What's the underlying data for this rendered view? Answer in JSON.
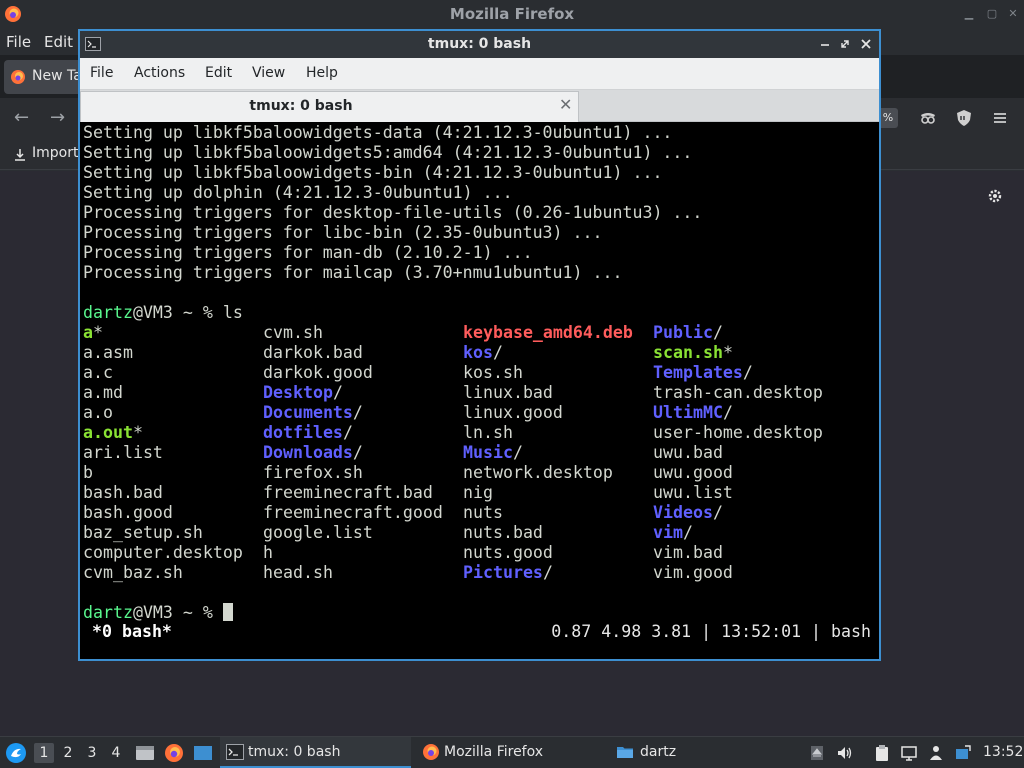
{
  "firefox": {
    "window_title": "Mozilla Firefox",
    "menu": {
      "file": "File",
      "edit": "Edit"
    },
    "tab_label": "New Tab",
    "zoom_label": "%",
    "bookmarks": {
      "import_label": "Import"
    }
  },
  "terminal": {
    "window_title": "tmux: 0 bash",
    "menu": {
      "file": "File",
      "actions": "Actions",
      "edit": "Edit",
      "view": "View",
      "help": "Help"
    },
    "tab_label": "tmux: 0 bash",
    "output_lines": [
      "Setting up libkf5baloowidgets-data (4:21.12.3-0ubuntu1) ...",
      "Setting up libkf5baloowidgets5:amd64 (4:21.12.3-0ubuntu1) ...",
      "Setting up libkf5baloowidgets-bin (4:21.12.3-0ubuntu1) ...",
      "Setting up dolphin (4:21.12.3-0ubuntu1) ...",
      "Processing triggers for desktop-file-utils (0.26-1ubuntu3) ...",
      "Processing triggers for libc-bin (2.35-0ubuntu3) ...",
      "Processing triggers for man-db (2.10.2-1) ...",
      "Processing triggers for mailcap (3.70+nmu1ubuntu1) ..."
    ],
    "prompt": {
      "user": "dartz",
      "host_path": "@VM3 ~ % ",
      "command": "ls"
    },
    "prompt2": {
      "user": "dartz",
      "host_path": "@VM3 ~ % "
    },
    "ls_columns": [
      [
        {
          "name": "a",
          "suffix": "*",
          "kind": "exec"
        },
        {
          "name": "a.asm",
          "suffix": "",
          "kind": "file"
        },
        {
          "name": "a.c",
          "suffix": "",
          "kind": "file"
        },
        {
          "name": "a.md",
          "suffix": "",
          "kind": "file"
        },
        {
          "name": "a.o",
          "suffix": "",
          "kind": "file"
        },
        {
          "name": "a.out",
          "suffix": "*",
          "kind": "exec"
        },
        {
          "name": "ari.list",
          "suffix": "",
          "kind": "file"
        },
        {
          "name": "b",
          "suffix": "",
          "kind": "file"
        },
        {
          "name": "bash.bad",
          "suffix": "",
          "kind": "file"
        },
        {
          "name": "bash.good",
          "suffix": "",
          "kind": "file"
        },
        {
          "name": "baz_setup.sh",
          "suffix": "",
          "kind": "file"
        },
        {
          "name": "computer.desktop",
          "suffix": "",
          "kind": "file"
        },
        {
          "name": "cvm_baz.sh",
          "suffix": "",
          "kind": "file"
        }
      ],
      [
        {
          "name": "cvm.sh",
          "suffix": "",
          "kind": "file"
        },
        {
          "name": "darkok.bad",
          "suffix": "",
          "kind": "file"
        },
        {
          "name": "darkok.good",
          "suffix": "",
          "kind": "file"
        },
        {
          "name": "Desktop",
          "suffix": "/",
          "kind": "dir"
        },
        {
          "name": "Documents",
          "suffix": "/",
          "kind": "dir"
        },
        {
          "name": "dotfiles",
          "suffix": "/",
          "kind": "dir"
        },
        {
          "name": "Downloads",
          "suffix": "/",
          "kind": "dir"
        },
        {
          "name": "firefox.sh",
          "suffix": "",
          "kind": "file"
        },
        {
          "name": "freeminecraft.bad",
          "suffix": "",
          "kind": "file"
        },
        {
          "name": "freeminecraft.good",
          "suffix": "",
          "kind": "file"
        },
        {
          "name": "google.list",
          "suffix": "",
          "kind": "file"
        },
        {
          "name": "h",
          "suffix": "",
          "kind": "file"
        },
        {
          "name": "head.sh",
          "suffix": "",
          "kind": "file"
        }
      ],
      [
        {
          "name": "keybase_amd64.deb",
          "suffix": "",
          "kind": "archive"
        },
        {
          "name": "kos",
          "suffix": "/",
          "kind": "dir"
        },
        {
          "name": "kos.sh",
          "suffix": "",
          "kind": "file"
        },
        {
          "name": "linux.bad",
          "suffix": "",
          "kind": "file"
        },
        {
          "name": "linux.good",
          "suffix": "",
          "kind": "file"
        },
        {
          "name": "ln.sh",
          "suffix": "",
          "kind": "file"
        },
        {
          "name": "Music",
          "suffix": "/",
          "kind": "dir"
        },
        {
          "name": "network.desktop",
          "suffix": "",
          "kind": "file"
        },
        {
          "name": "nig",
          "suffix": "",
          "kind": "file"
        },
        {
          "name": "nuts",
          "suffix": "",
          "kind": "file"
        },
        {
          "name": "nuts.bad",
          "suffix": "",
          "kind": "file"
        },
        {
          "name": "nuts.good",
          "suffix": "",
          "kind": "file"
        },
        {
          "name": "Pictures",
          "suffix": "/",
          "kind": "dir"
        }
      ],
      [
        {
          "name": "Public",
          "suffix": "/",
          "kind": "dir"
        },
        {
          "name": "scan.sh",
          "suffix": "*",
          "kind": "exec"
        },
        {
          "name": "Templates",
          "suffix": "/",
          "kind": "dir"
        },
        {
          "name": "trash-can.desktop",
          "suffix": "",
          "kind": "file"
        },
        {
          "name": "UltimMC",
          "suffix": "/",
          "kind": "dir"
        },
        {
          "name": "user-home.desktop",
          "suffix": "",
          "kind": "file"
        },
        {
          "name": "uwu.bad",
          "suffix": "",
          "kind": "file"
        },
        {
          "name": "uwu.good",
          "suffix": "",
          "kind": "file"
        },
        {
          "name": "uwu.list",
          "suffix": "",
          "kind": "file"
        },
        {
          "name": "Videos",
          "suffix": "/",
          "kind": "dir"
        },
        {
          "name": "vim",
          "suffix": "/",
          "kind": "dir"
        },
        {
          "name": "vim.bad",
          "suffix": "",
          "kind": "file"
        },
        {
          "name": "vim.good",
          "suffix": "",
          "kind": "file"
        }
      ]
    ],
    "status": {
      "left": "*0 bash*",
      "right": "0.87 4.98 3.81 | 13:52:01 | bash"
    }
  },
  "taskbar": {
    "desktops": [
      "1",
      "2",
      "3",
      "4"
    ],
    "tasks": [
      {
        "label": "tmux: 0 bash"
      },
      {
        "label": "Mozilla Firefox"
      },
      {
        "label": "dartz"
      }
    ],
    "clock": "13:52"
  },
  "colors": {
    "accent": "#3d8fd1",
    "terminal_bg": "#000000",
    "ls_dir": "#6060ff",
    "ls_exec": "#8ae234",
    "ls_archive": "#ff5c5c",
    "prompt_user": "#5af78e"
  }
}
